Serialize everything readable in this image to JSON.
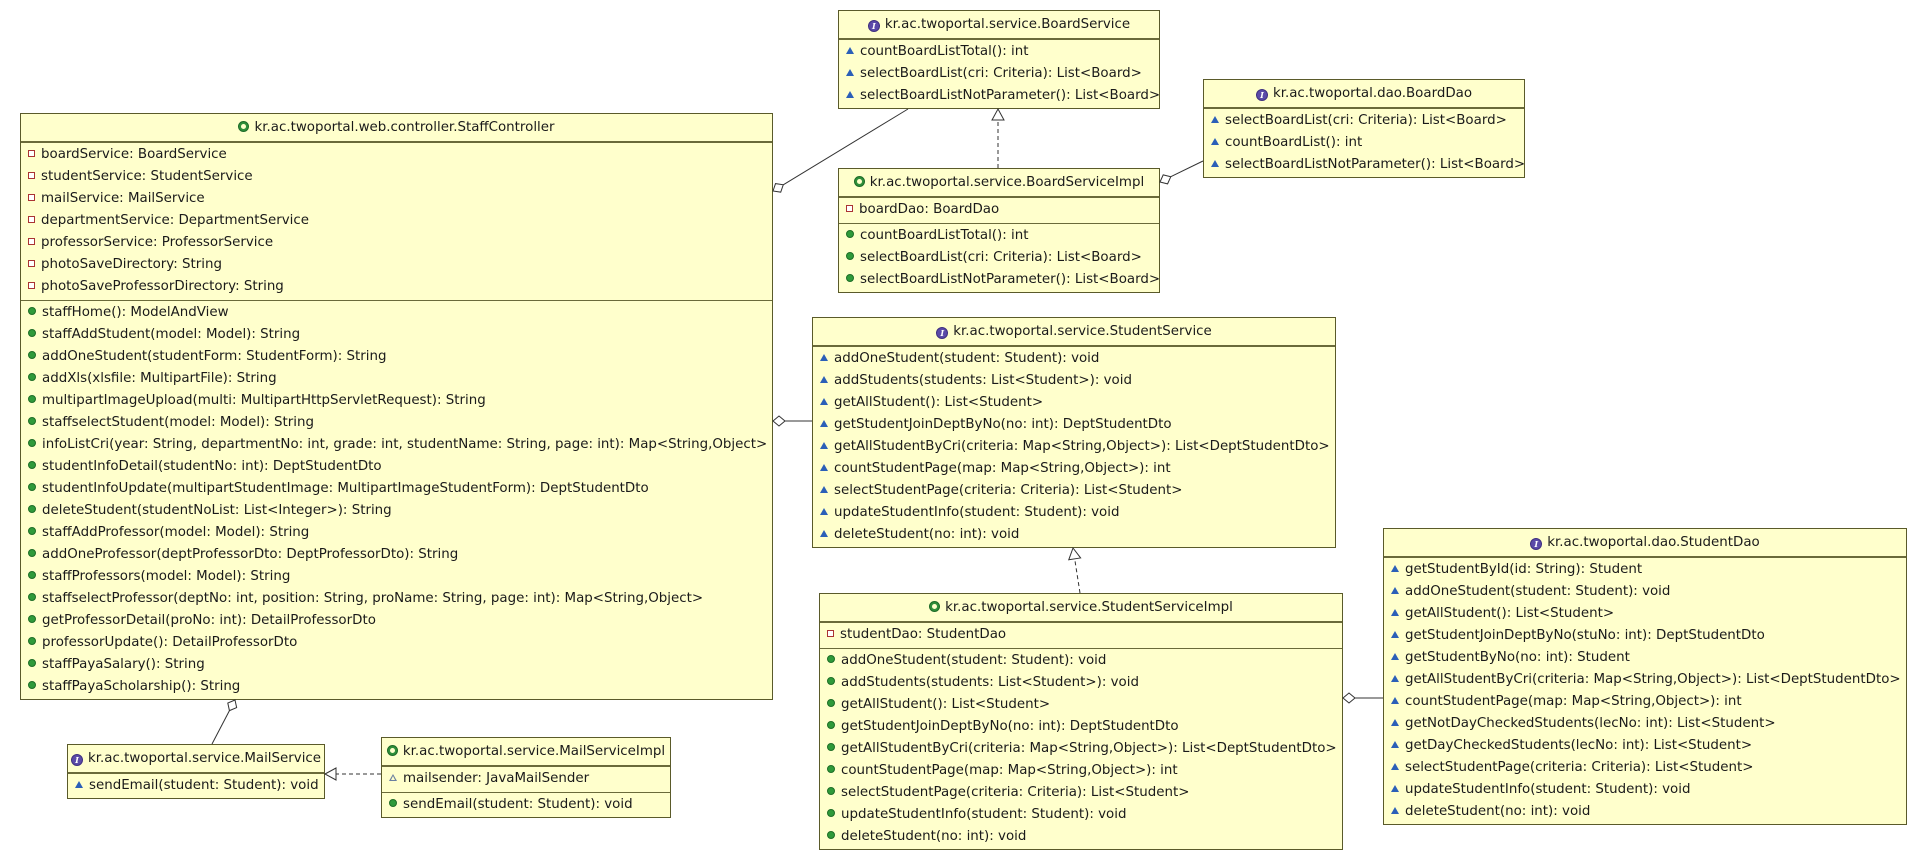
{
  "classes": {
    "board_service": {
      "title": "kr.ac.twoportal.service.BoardService",
      "methods": [
        "countBoardListTotal(): int",
        "selectBoardList(cri: Criteria): List<Board>",
        "selectBoardListNotParameter(): List<Board>"
      ]
    },
    "board_dao": {
      "title": "kr.ac.twoportal.dao.BoardDao",
      "methods": [
        "selectBoardList(cri: Criteria): List<Board>",
        "countBoardList(): int",
        "selectBoardListNotParameter(): List<Board>"
      ]
    },
    "board_service_impl": {
      "title": "kr.ac.twoportal.service.BoardServiceImpl",
      "fields": [
        "boardDao: BoardDao"
      ],
      "methods": [
        "countBoardListTotal(): int",
        "selectBoardList(cri: Criteria): List<Board>",
        "selectBoardListNotParameter(): List<Board>"
      ]
    },
    "staff_controller": {
      "title": "kr.ac.twoportal.web.controller.StaffController",
      "fields": [
        "boardService: BoardService",
        "studentService: StudentService",
        "mailService: MailService",
        "departmentService: DepartmentService",
        "professorService: ProfessorService",
        "photoSaveDirectory: String",
        "photoSaveProfessorDirectory: String"
      ],
      "methods": [
        "staffHome(): ModelAndView",
        "staffAddStudent(model: Model): String",
        "addOneStudent(studentForm: StudentForm): String",
        "addXls(xlsfile: MultipartFile): String",
        "multipartImageUpload(multi: MultipartHttpServletRequest): String",
        "staffselectStudent(model: Model): String",
        "infoListCri(year: String, departmentNo: int, grade: int, studentName: String, page: int): Map<String,Object>",
        "studentInfoDetail(studentNo: int): DeptStudentDto",
        "studentInfoUpdate(multipartStudentImage: MultipartImageStudentForm): DeptStudentDto",
        "deleteStudent(studentNoList: List<Integer>): String",
        "staffAddProfessor(model: Model): String",
        "addOneProfessor(deptProfessorDto: DeptProfessorDto): String",
        "staffProfessors(model: Model): String",
        "staffselectProfessor(deptNo: int, position: String, proName: String, page: int): Map<String,Object>",
        "getProfessorDetail(proNo: int): DetailProfessorDto",
        "professorUpdate(): DetailProfessorDto",
        "staffPayaSalary(): String",
        "staffPayaScholarship(): String"
      ]
    },
    "student_service": {
      "title": "kr.ac.twoportal.service.StudentService",
      "methods": [
        "addOneStudent(student: Student): void",
        "addStudents(students: List<Student>): void",
        "getAllStudent(): List<Student>",
        "getStudentJoinDeptByNo(no: int): DeptStudentDto",
        "getAllStudentByCri(criteria: Map<String,Object>): List<DeptStudentDto>",
        "countStudentPage(map: Map<String,Object>): int",
        "selectStudentPage(criteria: Criteria): List<Student>",
        "updateStudentInfo(student: Student): void",
        "deleteStudent(no: int): void"
      ]
    },
    "student_service_impl": {
      "title": "kr.ac.twoportal.service.StudentServiceImpl",
      "fields": [
        "studentDao: StudentDao"
      ],
      "methods": [
        "addOneStudent(student: Student): void",
        "addStudents(students: List<Student>): void",
        "getAllStudent(): List<Student>",
        "getStudentJoinDeptByNo(no: int): DeptStudentDto",
        "getAllStudentByCri(criteria: Map<String,Object>): List<DeptStudentDto>",
        "countStudentPage(map: Map<String,Object>): int",
        "selectStudentPage(criteria: Criteria): List<Student>",
        "updateStudentInfo(student: Student): void",
        "deleteStudent(no: int): void"
      ]
    },
    "student_dao": {
      "title": "kr.ac.twoportal.dao.StudentDao",
      "methods": [
        "getStudentById(id: String): Student",
        "addOneStudent(student: Student): void",
        "getAllStudent(): List<Student>",
        "getStudentJoinDeptByNo(stuNo: int): DeptStudentDto",
        "getStudentByNo(no: int): Student",
        "getAllStudentByCri(criteria: Map<String,Object>): List<DeptStudentDto>",
        "countStudentPage(map: Map<String,Object>): int",
        "getNotDayCheckedStudents(lecNo: int): List<Student>",
        "getDayCheckedStudents(lecNo: int): List<Student>",
        "selectStudentPage(criteria: Criteria): List<Student>",
        "updateStudentInfo(student: Student): void",
        "deleteStudent(no: int): void"
      ]
    },
    "mail_service": {
      "title": "kr.ac.twoportal.service.MailService",
      "methods": [
        "sendEmail(student: Student): void"
      ]
    },
    "mail_service_impl": {
      "title": "kr.ac.twoportal.service.MailServiceImpl",
      "fields": [
        "mailsender: JavaMailSender"
      ],
      "methods": [
        "sendEmail(student: Student): void"
      ]
    }
  },
  "colors": {
    "box_fill": "#ffffcc",
    "box_border": "#5a5a2a",
    "edge": "#333333"
  }
}
